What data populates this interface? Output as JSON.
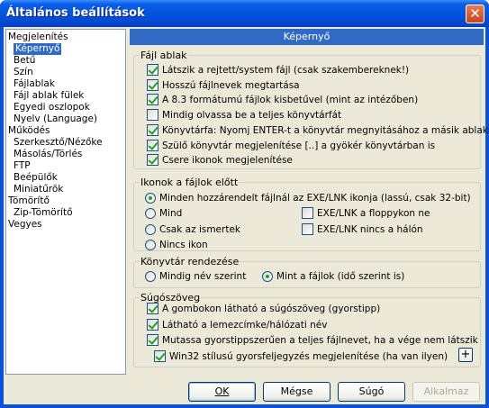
{
  "window": {
    "title": "Általános beállítások"
  },
  "tree": [
    {
      "label": "Megjelenítés",
      "level": 0
    },
    {
      "label": "Képernyő",
      "level": 1,
      "selected": true
    },
    {
      "label": "Betű",
      "level": 1
    },
    {
      "label": "Szín",
      "level": 1
    },
    {
      "label": "Fájlablak",
      "level": 1
    },
    {
      "label": "Fájl ablak fülek",
      "level": 1
    },
    {
      "label": "Egyedi oszlopok",
      "level": 1
    },
    {
      "label": "Nyelv (Language)",
      "level": 1
    },
    {
      "label": "Működés",
      "level": 0
    },
    {
      "label": "Szerkesztő/Nézőke",
      "level": 1
    },
    {
      "label": "Másolás/Törlés",
      "level": 1
    },
    {
      "label": "FTP",
      "level": 1
    },
    {
      "label": "Beépülők",
      "level": 1
    },
    {
      "label": "Miniatűrök",
      "level": 1
    },
    {
      "label": "Tömörítő",
      "level": 0
    },
    {
      "label": "Zip-Tömörítő",
      "level": 1
    },
    {
      "label": "Vegyes",
      "level": 0
    }
  ],
  "header": {
    "title": "Képernyő"
  },
  "file_window": {
    "title": "Fájl ablak",
    "options": [
      {
        "label": "Látszik a rejtett/system fájl (csak szakembereknek!)",
        "checked": true
      },
      {
        "label": "Hosszú fájlnevek megtartása",
        "checked": true
      },
      {
        "label": "A 8.3 formátumú fájlok kisbetűvel (mint az intézőben)",
        "checked": true
      },
      {
        "label": "Mindig olvassa be a teljes könyvtárfát",
        "checked": false
      },
      {
        "label": "Könyvtárfa: Nyomj ENTER-t a könyvtár megnyitásához a másik ablakba",
        "checked": true
      },
      {
        "label": "Szülő könyvtár megjelenítése [..] a gyökér könyvtárban is",
        "checked": true
      },
      {
        "label": "Csere ikonok megjelenítése",
        "checked": true
      }
    ]
  },
  "icons": {
    "title": "Ikonok a fájlok előtt",
    "radios": [
      {
        "label": "Minden hozzárendelt fájlnál az EXE/LNK ikonja (lassú, csak 32-bit)",
        "checked": true
      },
      {
        "label": "Mind",
        "checked": false
      },
      {
        "label": "Csak az ismertek",
        "checked": false
      },
      {
        "label": "Nincs ikon",
        "checked": false
      }
    ],
    "checks": [
      {
        "label": "EXE/LNK a floppykon ne",
        "checked": false
      },
      {
        "label": "EXE/LNK nincs a hálón",
        "checked": false
      }
    ]
  },
  "sort": {
    "title": "Könyvtár rendezése",
    "radios": [
      {
        "label": "Mindig név szerint",
        "checked": false
      },
      {
        "label": "Mint a fájlok (idő szerint is)",
        "checked": true
      }
    ]
  },
  "tooltips": {
    "title": "Súgószöveg",
    "options": [
      {
        "label": "A gombokon látható a súgószöveg (gyorstipp)",
        "checked": true
      },
      {
        "label": "Látható a lemezcímke/hálózati név",
        "checked": true
      },
      {
        "label": "Mutassa gyorstippszerűen a teljes fájlnevet, ha a vége nem látszik",
        "checked": true
      },
      {
        "label": "Win32 stílusú gyorsfeljegyzés megjelenítése (ha van ilyen)",
        "checked": true
      }
    ],
    "plus_label": "+"
  },
  "buttons": {
    "ok": "OK",
    "cancel": "Mégse",
    "help": "Súgó",
    "apply": "Alkalmaz"
  }
}
